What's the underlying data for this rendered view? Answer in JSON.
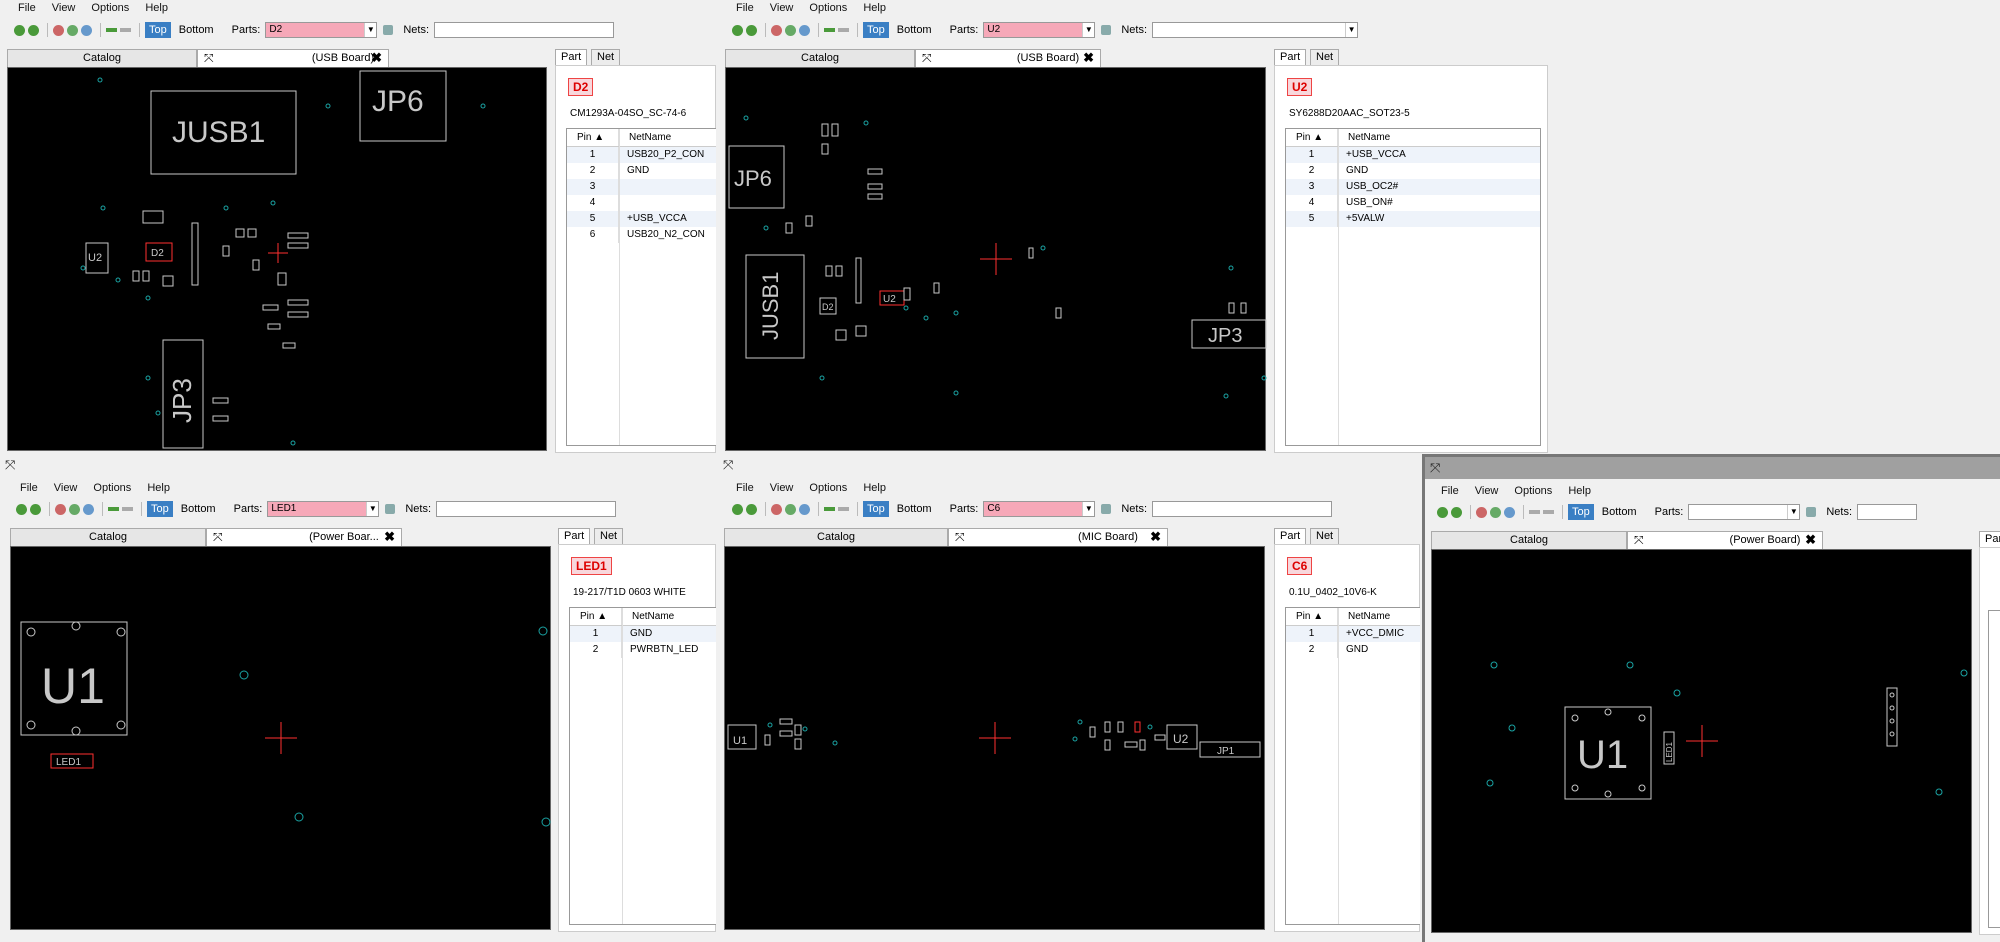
{
  "menu": [
    "File",
    "View",
    "Options",
    "Help"
  ],
  "layers": {
    "top": "Top",
    "bottom": "Bottom"
  },
  "labels": {
    "parts": "Parts:",
    "nets": "Nets:",
    "part_tab": "Part",
    "net_tab": "Net",
    "catalog": "Catalog",
    "pin_col": "Pin",
    "netname_col": "NetName"
  },
  "windows": [
    {
      "board": "(USB Board)",
      "part": "D2",
      "part_name": "CM1293A-04SO_SC-74-6",
      "pins": [
        [
          "1",
          "USB20_P2_CON"
        ],
        [
          "2",
          "GND"
        ],
        [
          "3",
          ""
        ],
        [
          "4",
          ""
        ],
        [
          "5",
          "+USB_VCCA"
        ],
        [
          "6",
          "USB20_N2_CON"
        ]
      ],
      "silk": {
        "big1": "JUSB1",
        "big2": "JP6",
        "big3": "JP3",
        "s1": "U2",
        "s2": "D2"
      }
    },
    {
      "board": "(USB Board)",
      "part": "U2",
      "part_name": "SY6288D20AAC_SOT23-5",
      "pins": [
        [
          "1",
          "+USB_VCCA"
        ],
        [
          "2",
          "GND"
        ],
        [
          "3",
          "USB_OC2#"
        ],
        [
          "4",
          "USB_ON#"
        ],
        [
          "5",
          "+5VALW"
        ]
      ],
      "silk": {
        "big1": "JP6",
        "big2": "JUSB1",
        "big3": "JP3",
        "s1": "U2",
        "s2": "D2"
      }
    },
    {
      "board": "(Power Boar...",
      "part": "LED1",
      "part_name": "19-217/T1D 0603 WHITE",
      "pins": [
        [
          "1",
          "GND"
        ],
        [
          "2",
          "PWRBTN_LED"
        ]
      ],
      "silk": {
        "big1": "U1",
        "s1": "LED1"
      }
    },
    {
      "board": "(MIC Board)",
      "part": "C6",
      "part_name": "0.1U_0402_10V6-K",
      "pins": [
        [
          "1",
          "+VCC_DMIC"
        ],
        [
          "2",
          "GND"
        ]
      ],
      "silk": {
        "s1": "U1",
        "s2": "U2",
        "s3": "JP1"
      }
    },
    {
      "board": "(Power Board)",
      "part": "",
      "part_name": "",
      "pins": [],
      "silk": {
        "big1": "U1",
        "s1": "LED1"
      }
    }
  ],
  "colors": {
    "highlight": "#ff3030",
    "layer_on": "#3a7fc4",
    "board_bg": "#000000",
    "silk": "#c8c8c8",
    "via": "#1aa3a3"
  }
}
